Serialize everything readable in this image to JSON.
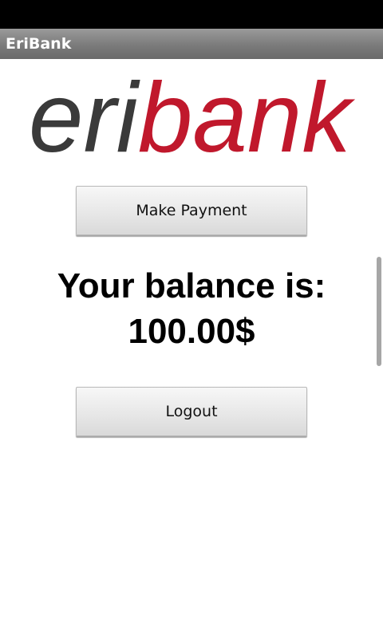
{
  "status_bar": {},
  "header": {
    "title": "EriBank"
  },
  "logo": {
    "part1": "eri",
    "part2": "bank",
    "colors": {
      "eri": "#3a3a3a",
      "bank": "#c0182c"
    }
  },
  "main": {
    "make_payment_label": "Make Payment",
    "balance_label": "Your balance is:",
    "balance_value": "100.00$",
    "logout_label": "Logout"
  },
  "colors": {
    "title_bar": "#7f7f7f",
    "status_bar": "#000000",
    "button_bg": "#e6e6e6"
  }
}
